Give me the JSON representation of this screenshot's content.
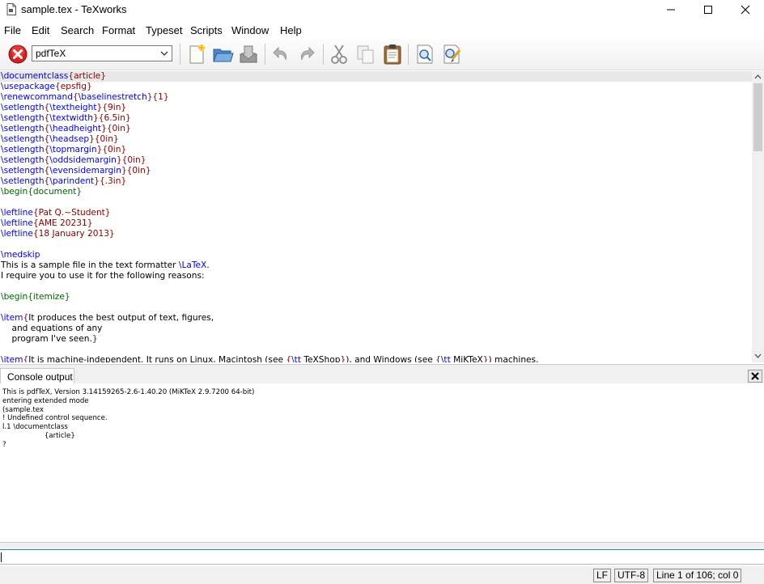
{
  "window": {
    "title": "sample.tex - TeXworks"
  },
  "menu": {
    "items": [
      "File",
      "Edit",
      "Search",
      "Format",
      "Typeset",
      "Scripts",
      "Window",
      "Help"
    ]
  },
  "toolbar": {
    "engine": "pdfTeX",
    "icons": [
      "stop-typeset-icon",
      "new-document-icon",
      "open-folder-icon",
      "save-icon",
      "undo-icon",
      "redo-icon",
      "cut-icon",
      "copy-icon",
      "paste-icon",
      "find-icon",
      "replace-icon"
    ]
  },
  "editor": {
    "lines": [
      [
        [
          "k",
          "\\documentclass"
        ],
        [
          "b",
          "{article}"
        ]
      ],
      [
        [
          "k",
          "\\usepackage"
        ],
        [
          "b",
          "{epsfig}"
        ]
      ],
      [
        [
          "k",
          "\\renewcommand"
        ],
        [
          "b",
          "{"
        ],
        [
          "k",
          "\\baselinestretch"
        ],
        [
          "b",
          "}{1}"
        ]
      ],
      [
        [
          "k",
          "\\setlength"
        ],
        [
          "b",
          "{"
        ],
        [
          "k",
          "\\textheight"
        ],
        [
          "b",
          "}{9in}"
        ]
      ],
      [
        [
          "k",
          "\\setlength"
        ],
        [
          "b",
          "{"
        ],
        [
          "k",
          "\\textwidth"
        ],
        [
          "b",
          "}{6.5in}"
        ]
      ],
      [
        [
          "k",
          "\\setlength"
        ],
        [
          "b",
          "{"
        ],
        [
          "k",
          "\\headheight"
        ],
        [
          "b",
          "}{0in}"
        ]
      ],
      [
        [
          "k",
          "\\setlength"
        ],
        [
          "b",
          "{"
        ],
        [
          "k",
          "\\headsep"
        ],
        [
          "b",
          "}{0in}"
        ]
      ],
      [
        [
          "k",
          "\\setlength"
        ],
        [
          "b",
          "{"
        ],
        [
          "k",
          "\\topmargin"
        ],
        [
          "b",
          "}{0in}"
        ]
      ],
      [
        [
          "k",
          "\\setlength"
        ],
        [
          "b",
          "{"
        ],
        [
          "k",
          "\\oddsidemargin"
        ],
        [
          "b",
          "}{0in}"
        ]
      ],
      [
        [
          "k",
          "\\setlength"
        ],
        [
          "b",
          "{"
        ],
        [
          "k",
          "\\evensidemargin"
        ],
        [
          "b",
          "}{0in}"
        ]
      ],
      [
        [
          "k",
          "\\setlength"
        ],
        [
          "b",
          "{"
        ],
        [
          "k",
          "\\parindent"
        ],
        [
          "b",
          "}{.3in}"
        ]
      ],
      [
        [
          "g",
          "\\begin{document}"
        ]
      ],
      [],
      [
        [
          "k",
          "\\leftline"
        ],
        [
          "b",
          "{Pat Q.~Student}"
        ]
      ],
      [
        [
          "k",
          "\\leftline"
        ],
        [
          "b",
          "{AME 20231}"
        ]
      ],
      [
        [
          "k",
          "\\leftline"
        ],
        [
          "b",
          "{18 January 2013}"
        ]
      ],
      [],
      [
        [
          "k",
          "\\medskip"
        ]
      ],
      [
        [
          "t",
          "This is a sample file in the text formatter "
        ],
        [
          "k",
          "\\LaTeX"
        ],
        [
          "t",
          "."
        ]
      ],
      [
        [
          "t",
          "I require you to use it for the following reasons:"
        ]
      ],
      [],
      [
        [
          "g",
          "\\begin{itemize}"
        ]
      ],
      [],
      [
        [
          "k",
          "\\item"
        ],
        [
          "b",
          "{"
        ],
        [
          "t",
          "It produces the best output of text, figures,"
        ]
      ],
      [
        [
          "t",
          "    and equations of any"
        ]
      ],
      [
        [
          "t",
          "    program I've seen."
        ],
        [
          "b",
          "}"
        ]
      ],
      [],
      [
        [
          "k",
          "\\item"
        ],
        [
          "b",
          "{"
        ],
        [
          "t",
          "It is machine-independent. It runs on Linux, Macintosh (see "
        ],
        [
          "b",
          "{"
        ],
        [
          "k",
          "\\tt"
        ],
        [
          "t",
          " TeXShop"
        ],
        [
          "b",
          "}"
        ],
        [
          "t",
          "), and Windows (see "
        ],
        [
          "b",
          "{"
        ],
        [
          "k",
          "\\tt"
        ],
        [
          "t",
          " MiKTeX"
        ],
        [
          "b",
          "}"
        ],
        [
          "t",
          ") machines."
        ]
      ]
    ]
  },
  "console": {
    "tab_label": "Console output",
    "lines": [
      "This is pdfTeX, Version 3.14159265-2.6-1.40.20 (MiKTeX 2.9.7200 64-bit)",
      "entering extended mode",
      "(sample.tex",
      "! Undefined control sequence.",
      "l.1 \\documentclass",
      "                   {article}",
      "?"
    ],
    "input_value": ""
  },
  "status": {
    "line_ending": "LF",
    "encoding": "UTF-8",
    "position": "Line 1 of 106; col 0"
  }
}
